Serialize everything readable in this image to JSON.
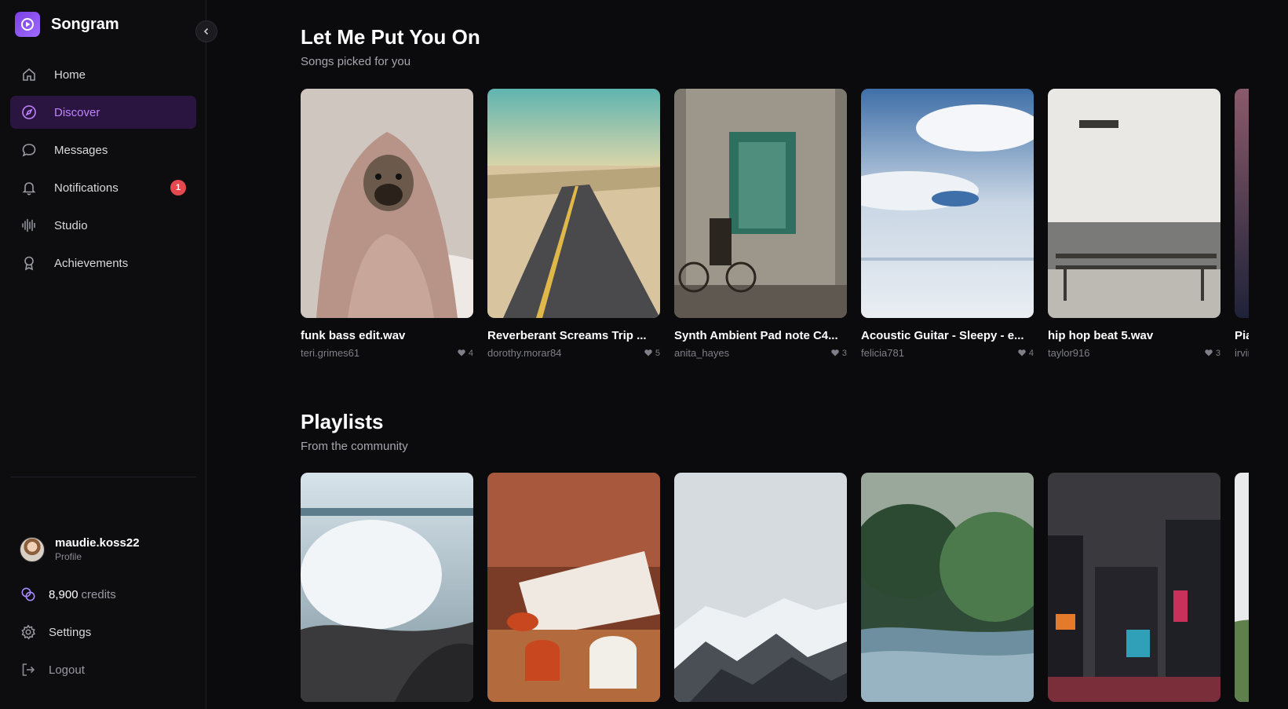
{
  "app": {
    "name": "Songram"
  },
  "nav": [
    {
      "id": "home",
      "label": "Home",
      "icon": "home-icon"
    },
    {
      "id": "discover",
      "label": "Discover",
      "icon": "compass-icon",
      "active": true
    },
    {
      "id": "messages",
      "label": "Messages",
      "icon": "message-icon"
    },
    {
      "id": "notifications",
      "label": "Notifications",
      "icon": "bell-icon",
      "badge": "1"
    },
    {
      "id": "studio",
      "label": "Studio",
      "icon": "waveform-icon"
    },
    {
      "id": "achievements",
      "label": "Achievements",
      "icon": "award-icon"
    }
  ],
  "profile": {
    "username": "maudie.koss22",
    "label": "Profile"
  },
  "credits": {
    "amount": "8,900",
    "unit": "credits"
  },
  "settings_label": "Settings",
  "logout_label": "Logout",
  "sections": {
    "songs": {
      "title": "Let Me Put You On",
      "subtitle": "Songs picked for you",
      "cards": [
        {
          "title": "funk bass edit.wav",
          "user": "teri.grimes61",
          "likes": "4"
        },
        {
          "title": "Reverberant Screams Trip ...",
          "user": "dorothy.morar84",
          "likes": "5"
        },
        {
          "title": "Synth Ambient Pad note C4...",
          "user": "anita_hayes",
          "likes": "3"
        },
        {
          "title": "Acoustic Guitar - Sleepy - e...",
          "user": "felicia781",
          "likes": "4"
        },
        {
          "title": "hip hop beat 5.wav",
          "user": "taylor916",
          "likes": "3"
        },
        {
          "title": "Pia",
          "user": "irvir",
          "likes": ""
        }
      ]
    },
    "playlists": {
      "title": "Playlists",
      "subtitle": "From the community"
    }
  },
  "colors": {
    "accent": "#c084fc",
    "active_bg": "#2a1440",
    "badge": "#e5484d",
    "bg": "#0b0b0d"
  }
}
